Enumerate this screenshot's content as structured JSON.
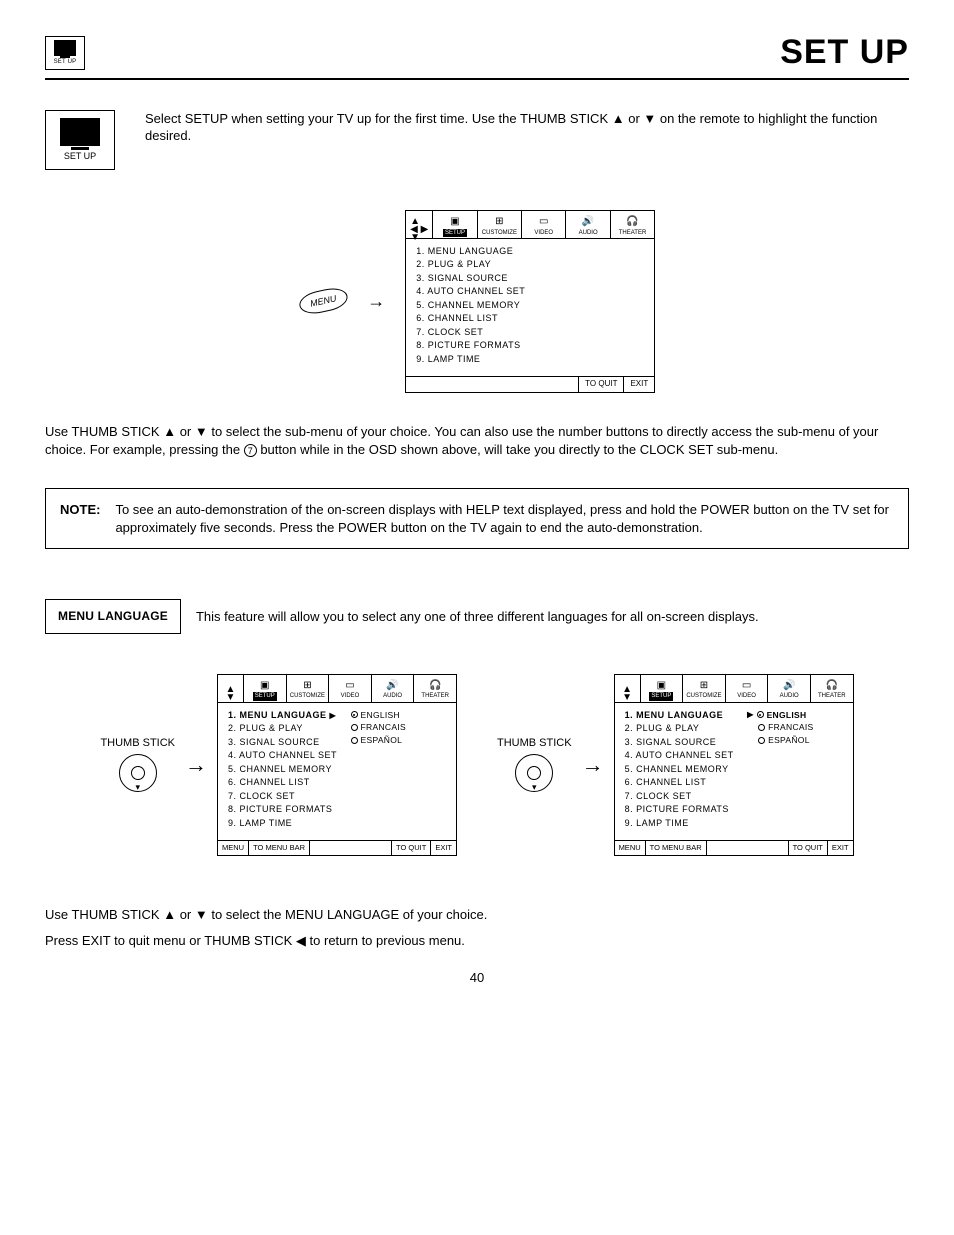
{
  "title": "SET UP",
  "setup_icon_label": "SET UP",
  "intro": "Select SETUP when setting your TV up for the first time.  Use the THUMB STICK ▲ or ▼ on the remote to highlight the function desired.",
  "menu_button": "MENU",
  "osd_tabs": [
    "SETUP",
    "CUSTOMIZE",
    "VIDEO",
    "AUDIO",
    "THEATER"
  ],
  "osd_items": [
    "1.  MENU LANGUAGE",
    "2.  PLUG & PLAY",
    "3.  SIGNAL SOURCE",
    "4.  AUTO CHANNEL SET",
    "5.  CHANNEL MEMORY",
    "6.  CHANNEL LIST",
    "7.  CLOCK SET",
    "8.  PICTURE FORMATS",
    "9.  LAMP TIME"
  ],
  "osd_footer_quit": "TO QUIT",
  "osd_footer_exit": "EXIT",
  "para1_a": "Use THUMB STICK ▲ or ▼ to select the sub-menu of your choice.  You can also use the number buttons to directly access the sub-menu of your choice.  For example, pressing the ",
  "para1_num": "7",
  "para1_b": " button while in the OSD shown above, will take you directly to the CLOCK SET sub-menu.",
  "note_label": "NOTE:",
  "note_text": "To see an auto-demonstration of the on-screen displays with HELP text displayed, press and hold the POWER button on the TV set for approximately five seconds. Press the POWER button on the TV again to end the auto-demonstration.",
  "menu_lang_label": "MENU LANGUAGE",
  "menu_lang_desc": "This feature will allow you to select any one of three different languages for all on-screen displays.",
  "thumb_label": "THUMB STICK",
  "osd2_items": [
    "1.  MENU LANGUAGE",
    "2.  PLUG & PLAY",
    "3.  SIGNAL SOURCE",
    "4.  AUTO CHANNEL SET",
    "5.  CHANNEL MEMORY",
    "6.  CHANNEL LIST",
    "7.  CLOCK SET",
    "8.  PICTURE FORMATS",
    "9.  LAMP TIME"
  ],
  "langs": [
    "ENGLISH",
    "FRANCAIS",
    "ESPAÑOL"
  ],
  "footer2_menu": "MENU",
  "footer2_bar": "TO MENU BAR",
  "footer2_quit": "TO QUIT",
  "footer2_exit": "EXIT",
  "instr1": "Use THUMB STICK ▲ or ▼ to select the MENU LANGUAGE of your choice.",
  "instr2": "Press EXIT to quit menu or THUMB STICK ◀ to return to previous menu.",
  "page": "40"
}
